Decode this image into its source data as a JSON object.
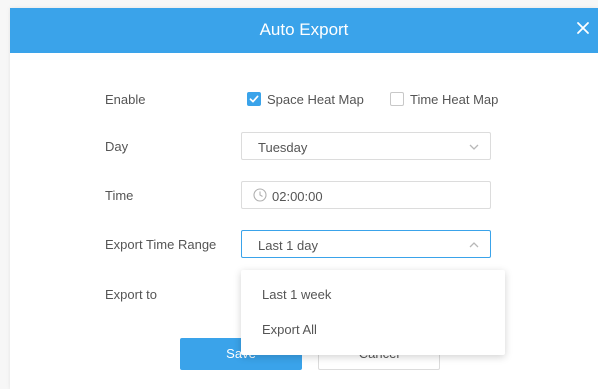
{
  "dialog": {
    "title": "Auto Export",
    "close_icon": "close-icon"
  },
  "form": {
    "enable": {
      "label": "Enable",
      "options": [
        {
          "label": "Space Heat Map",
          "checked": true
        },
        {
          "label": "Time Heat Map",
          "checked": false
        }
      ]
    },
    "day": {
      "label": "Day",
      "value": "Tuesday",
      "icon": "chevron-down-icon"
    },
    "time": {
      "label": "Time",
      "value": "02:00:00",
      "icon": "clock-icon"
    },
    "export_time_range": {
      "label": "Export Time Range",
      "value": "Last 1 day",
      "icon": "chevron-up-icon",
      "options": [
        "Last 1 week",
        "Export All"
      ]
    },
    "export_to": {
      "label": "Export to"
    }
  },
  "buttons": {
    "save": "Save",
    "cancel": "Cancel"
  },
  "colors": {
    "accent": "#3aa3ea"
  }
}
